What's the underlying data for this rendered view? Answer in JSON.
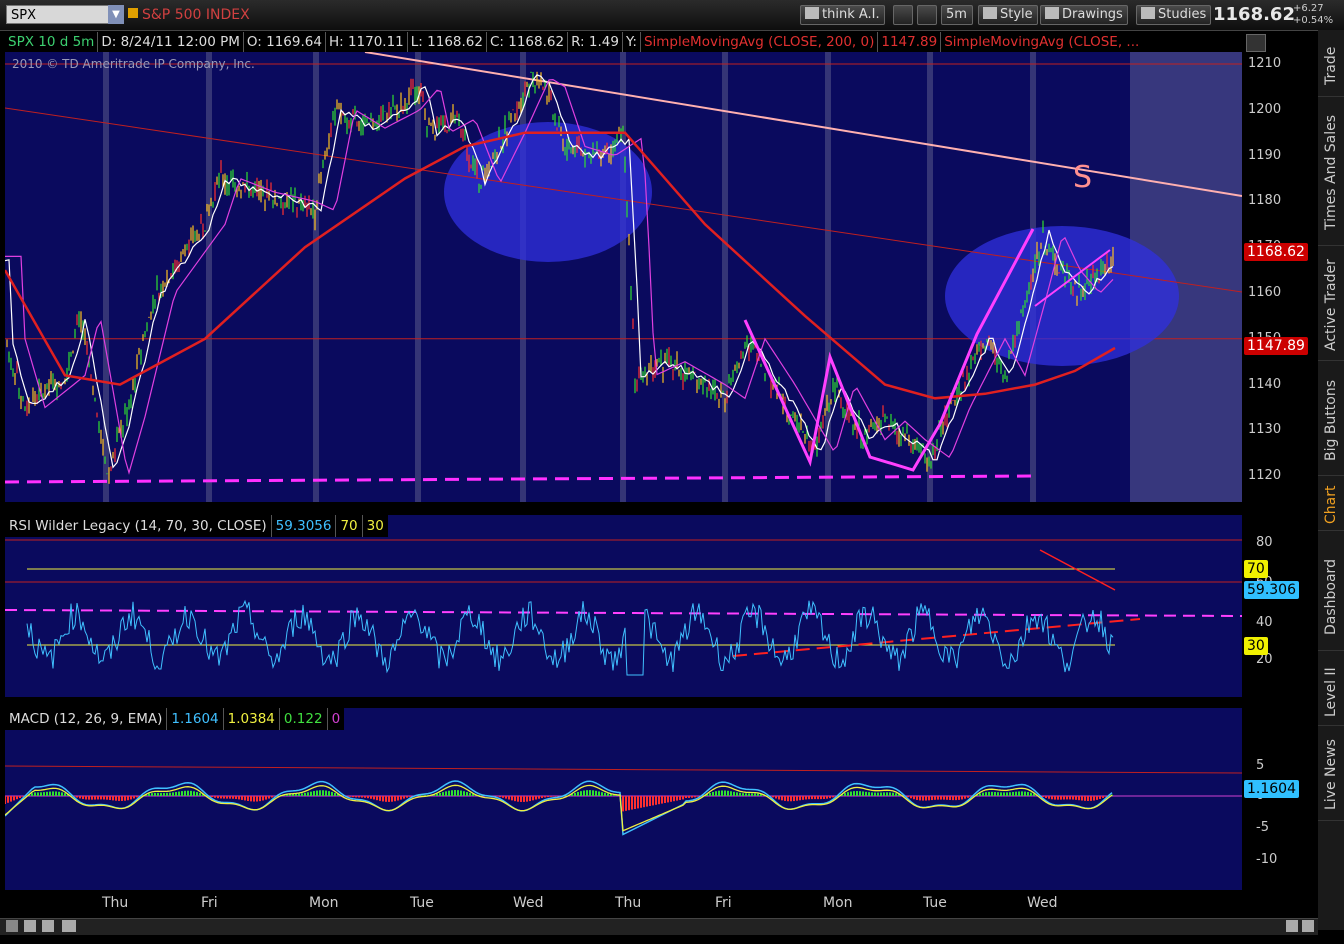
{
  "toolbar": {
    "symbol": "SPX",
    "name": "S&P 500 INDEX",
    "buttons": [
      "think A.I.",
      "5m",
      "Style",
      "Drawings",
      "Studies"
    ],
    "last_price": "1168.62",
    "change_abs": "+6.27",
    "change_pct": "+0.54%"
  },
  "header": {
    "title": "SPX 10 d 5m",
    "date": "D: 8/24/11 12:00 PM",
    "open": "O: 1169.64",
    "high": "H: 1170.11",
    "low": "L: 1168.62",
    "close": "C: 1168.62",
    "range": "R: 1.49",
    "y": "Y:",
    "sma200": "SimpleMovingAvg (CLOSE, 200, 0)",
    "sma200_val": "1147.89",
    "sma2": "SimpleMovingAvg (CLOSE, ..."
  },
  "watermark": "2010 © TD Ameritrade IP Company, Inc.",
  "annotation_s": "S",
  "price_axis": [
    "1210",
    "1200",
    "1190",
    "1180",
    "1170",
    "1160",
    "1150",
    "1140",
    "1130",
    "1120"
  ],
  "price_tags": {
    "last": "1168.62",
    "sma": "1147.89"
  },
  "rsi": {
    "title": "RSI Wilder Legacy (14, 70, 30, CLOSE)",
    "value": "59.3056",
    "ob": "70",
    "os": "30",
    "axis": [
      "80",
      "60",
      "40",
      "20"
    ],
    "tag": "59.306",
    "tag70": "70",
    "tag30": "30"
  },
  "macd": {
    "title": "MACD (12, 26, 9, EMA)",
    "v1": "1.1604",
    "v2": "1.0384",
    "v3": "0.122",
    "v4": "0",
    "axis": [
      "5",
      "0",
      "-5",
      "-10"
    ],
    "tag": "1.1604"
  },
  "days": [
    "Thu",
    "Fri",
    "Mon",
    "Tue",
    "Wed",
    "Thu",
    "Fri",
    "Mon",
    "Tue",
    "Wed"
  ],
  "side_tabs": [
    "Trade",
    "Times And Sales",
    "Active Trader",
    "Big Buttons",
    "Chart",
    "Dashboard",
    "Level II",
    "Live News"
  ],
  "colors": {
    "panel": "#0a0a5e",
    "price_tag": "#cc0000",
    "rsi_line": "#40c0ff",
    "sma": "#e02020",
    "pink": "#ff40ff"
  },
  "chart_data": {
    "type": "line",
    "title": "SPX 10 d 5m",
    "ylim": [
      1115,
      1212
    ],
    "x": [
      "Thu",
      "Fri",
      "Mon",
      "Tue",
      "Wed",
      "Thu",
      "Fri",
      "Mon",
      "Tue",
      "Wed"
    ],
    "series": [
      {
        "name": "SPX",
        "values": [
          1135,
          1180,
          1195,
          1198,
          1192,
          1140,
          1135,
          1130,
          1145,
          1168
        ]
      },
      {
        "name": "SimpleMovingAvg (CLOSE, 200, 0)",
        "values": [
          1140,
          1165,
          1180,
          1190,
          1195,
          1170,
          1150,
          1140,
          1135,
          1148
        ]
      }
    ]
  }
}
